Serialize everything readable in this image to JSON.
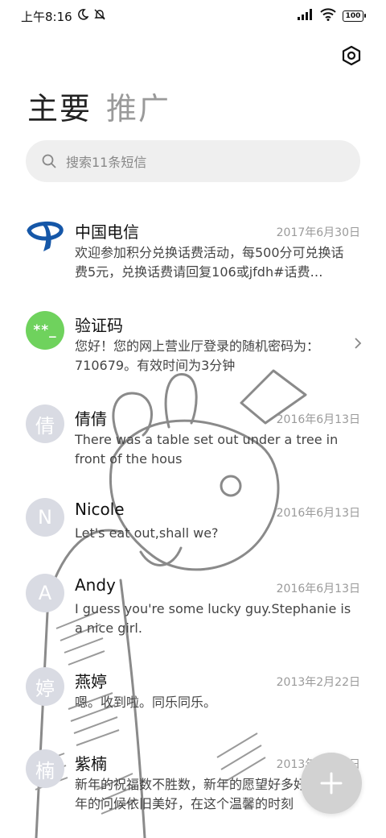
{
  "status_bar": {
    "time": "上午8:16",
    "battery": "100"
  },
  "tabs": [
    {
      "label": "主要"
    },
    {
      "label": "推广"
    }
  ],
  "search": {
    "placeholder": "搜索11条短信"
  },
  "conversations": [
    {
      "avatar": "telecom-logo",
      "name": "中国电信",
      "date": "2017年6月30日",
      "preview": "欢迎参加积分兑换话费活动，每500分可兑换话费5元，兑换话费请回复106或jfdh#话费…"
    },
    {
      "avatar": "**_",
      "name": "验证码",
      "date": "",
      "preview": "您好！您的网上营业厅登录的随机密码为：710679。有效时间为3分钟"
    },
    {
      "avatar": "倩",
      "name": "倩倩",
      "date": "2016年6月13日",
      "preview": "There was a table set out under a tree in front of the hous"
    },
    {
      "avatar": "N",
      "name": "Nicole",
      "date": "2016年6月13日",
      "preview": "Let's eat out,shall we?"
    },
    {
      "avatar": "A",
      "name": "Andy",
      "date": "2016年6月13日",
      "preview": "I guess you're some lucky guy.Stephanie is a nice girl."
    },
    {
      "avatar": "婷",
      "name": "燕婷",
      "date": "2013年2月22日",
      "preview": "嗯。收到啦。同乐同乐。"
    },
    {
      "avatar": "楠",
      "name": "紫楠",
      "date": "2013年2月22日",
      "preview": "新年的祝福数不胜数，新年的愿望好多好多，新年的问候依旧美好，在这个温馨的时刻"
    }
  ],
  "colors": {
    "accent_green": "#6fd25d",
    "telecom_blue": "#1557a8",
    "avatar_gray": "#d9dbe3"
  }
}
